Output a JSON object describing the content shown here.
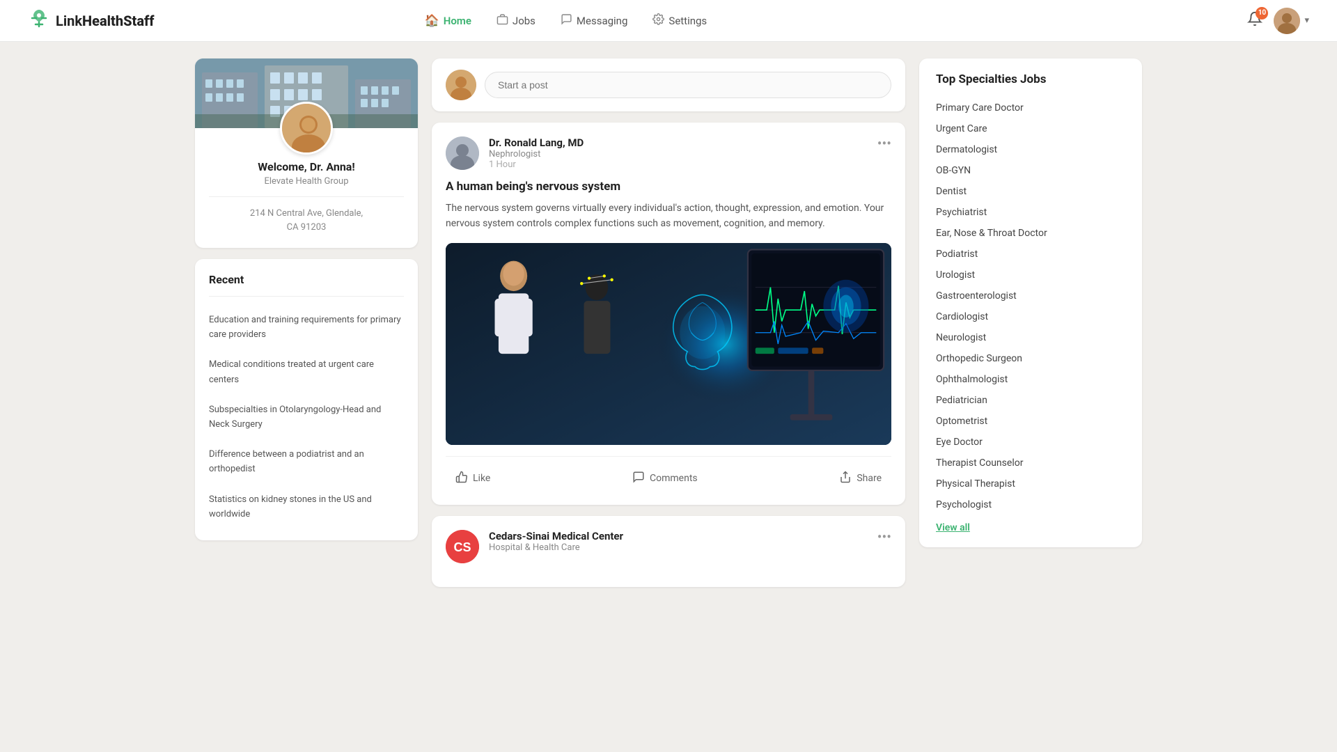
{
  "app": {
    "name": "LinkHealthStaff",
    "logo_icon": "✛"
  },
  "nav": {
    "links": [
      {
        "id": "home",
        "label": "Home",
        "icon": "🏠",
        "active": true
      },
      {
        "id": "jobs",
        "label": "Jobs",
        "icon": "💼",
        "active": false
      },
      {
        "id": "messaging",
        "label": "Messaging",
        "icon": "💬",
        "active": false
      },
      {
        "id": "settings",
        "label": "Settings",
        "icon": "⚙️",
        "active": false
      }
    ],
    "notification_count": "10",
    "chevron": "▾"
  },
  "profile": {
    "welcome": "Welcome, Dr. Anna!",
    "organization": "Elevate Health Group",
    "address_line1": "214 N Central Ave, Glendale,",
    "address_line2": "CA 91203"
  },
  "recent": {
    "title": "Recent",
    "items": [
      {
        "text": "Education and training requirements for primary care providers"
      },
      {
        "text": "Medical conditions treated at urgent care centers"
      },
      {
        "text": "Subspecialties in Otolaryngology-Head and Neck Surgery"
      },
      {
        "text": "Difference between a podiatrist and an orthopedist"
      },
      {
        "text": "Statistics on kidney stones in the US and worldwide"
      }
    ]
  },
  "post_create": {
    "placeholder": "Start a post"
  },
  "feed": [
    {
      "id": "post1",
      "author": "Dr. Ronald Lang, MD",
      "role": "Nephrologist",
      "time": "1 Hour",
      "title": "A human being's nervous system",
      "body": "The nervous system governs virtually every individual's action, thought, expression, and emotion. Your nervous system controls complex functions such as movement, cognition, and memory.",
      "has_image": true,
      "actions": [
        {
          "id": "like",
          "label": "Like",
          "icon": "👍"
        },
        {
          "id": "comments",
          "label": "Comments",
          "icon": "💬"
        },
        {
          "id": "share",
          "label": "Share",
          "icon": "↗"
        }
      ]
    },
    {
      "id": "post2",
      "author": "Cedars-Sinai Medical Center",
      "role": "Hospital & Health Care",
      "has_image": false
    }
  ],
  "specialties": {
    "title": "Top Specialties Jobs",
    "items": [
      "Primary Care Doctor",
      "Urgent Care",
      "Dermatologist",
      "OB-GYN",
      "Dentist",
      "Psychiatrist",
      "Ear, Nose & Throat Doctor",
      "Podiatrist",
      "Urologist",
      "Gastroenterologist",
      "Cardiologist",
      "Neurologist",
      "Orthopedic Surgeon",
      "Ophthalmologist",
      "Pediatrician",
      "Optometrist",
      "Eye Doctor",
      "Therapist Counselor",
      "Physical Therapist",
      "Psychologist"
    ],
    "view_all": "View all"
  }
}
